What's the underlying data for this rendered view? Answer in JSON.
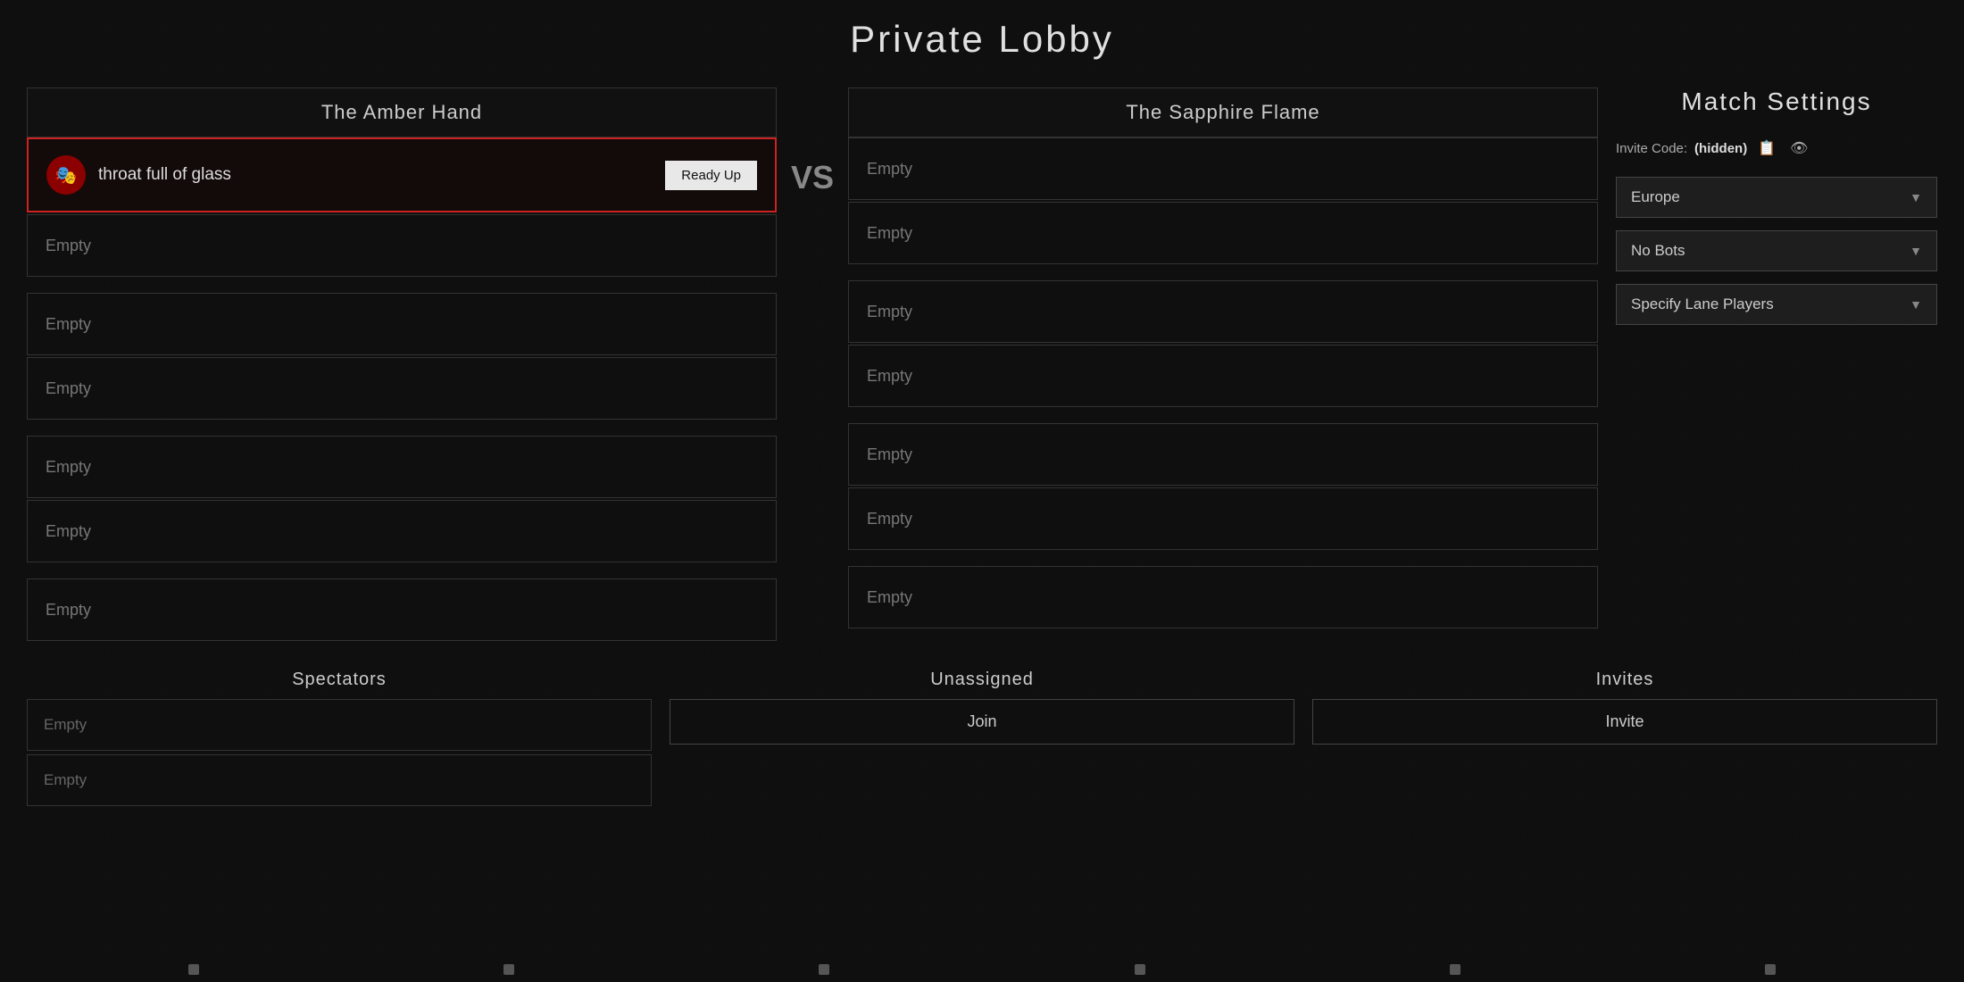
{
  "page": {
    "title": "Private Lobby"
  },
  "settings": {
    "title": "Match Settings",
    "invite_code_label": "Invite Code:",
    "invite_code_value": "(hidden)",
    "region": "Europe",
    "bots": "No Bots",
    "lane_players": "Specify Lane Players"
  },
  "team_amber": {
    "name": "The Amber Hand",
    "players": [
      {
        "name": "throat full of glass",
        "status": "active",
        "ready": true
      },
      {
        "name": "Empty",
        "status": "empty"
      }
    ],
    "extra_slots": [
      {
        "name": "Empty"
      },
      {
        "name": "Empty"
      },
      {
        "name": "Empty"
      },
      {
        "name": "Empty"
      },
      {
        "name": "Empty"
      }
    ]
  },
  "team_sapphire": {
    "name": "The Sapphire Flame",
    "players": [
      {
        "name": "Empty",
        "status": "empty"
      },
      {
        "name": "Empty",
        "status": "empty"
      },
      {
        "name": "Empty",
        "status": "empty"
      },
      {
        "name": "Empty",
        "status": "empty"
      },
      {
        "name": "Empty",
        "status": "empty"
      },
      {
        "name": "Empty",
        "status": "empty"
      },
      {
        "name": "Empty",
        "status": "empty"
      }
    ]
  },
  "vs_label": "VS",
  "spectators": {
    "title": "Spectators",
    "slots": [
      {
        "name": "Empty"
      },
      {
        "name": "Empty"
      }
    ]
  },
  "unassigned": {
    "title": "Unassigned",
    "join_btn": "Join"
  },
  "invites": {
    "title": "Invites",
    "invite_btn": "Invite"
  },
  "ready_up_label": "Ready Up",
  "copy_icon": "📋",
  "eye_icon": "👁",
  "chevron": "▼"
}
